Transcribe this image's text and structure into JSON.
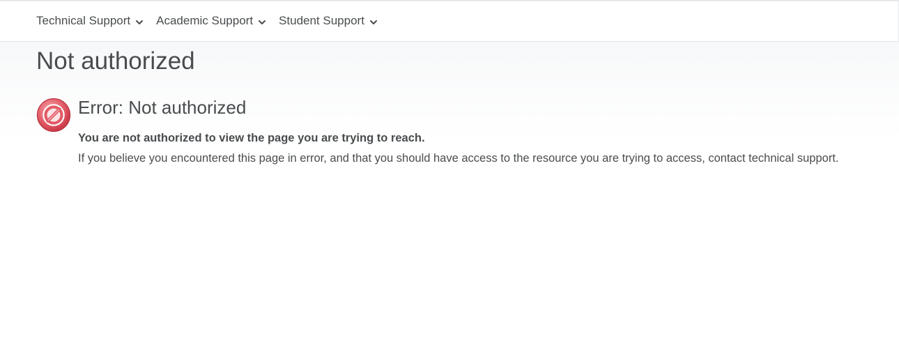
{
  "nav": {
    "items": [
      {
        "label": "Technical Support",
        "icon": "chevron-down-icon"
      },
      {
        "label": "Academic Support",
        "icon": "chevron-down-icon"
      },
      {
        "label": "Student Support",
        "icon": "chevron-down-icon"
      }
    ]
  },
  "page": {
    "title": "Not authorized"
  },
  "error": {
    "icon": "prohibited-icon",
    "icon_color": "#e25a66",
    "heading": "Error: Not authorized",
    "message": "You are not authorized to view the page you are trying to reach.",
    "detail": "If you believe you encountered this page in error, and that you should have access to the resource you are trying to access, contact technical support."
  }
}
